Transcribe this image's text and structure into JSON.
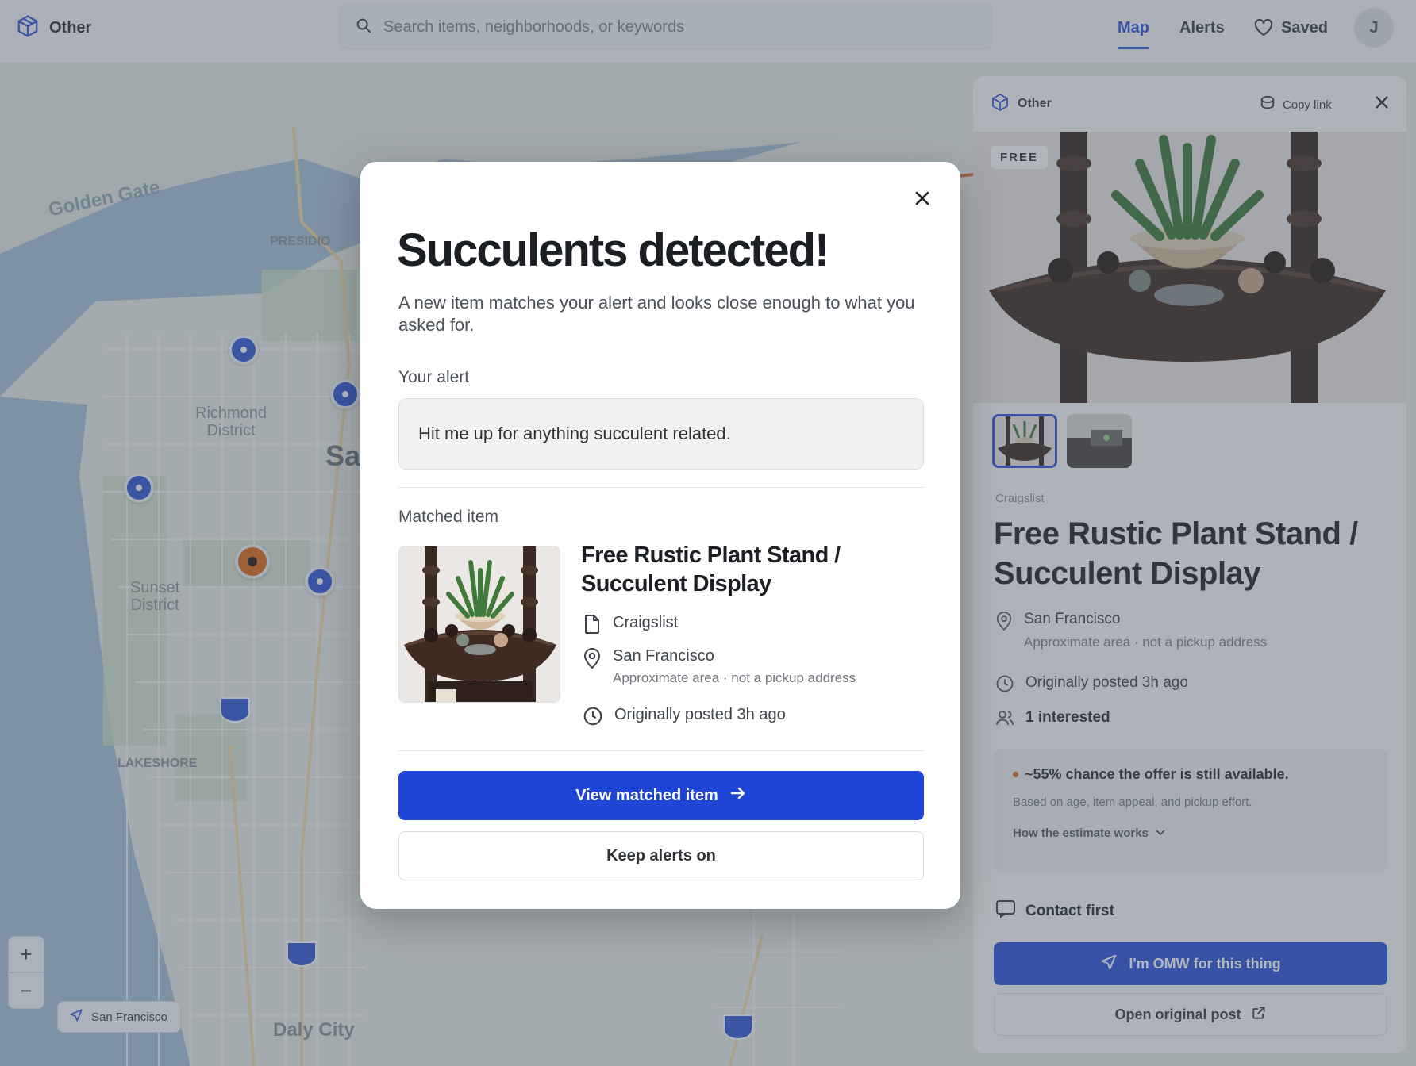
{
  "brand": {
    "label": "Other"
  },
  "search": {
    "placeholder": "Search items, neighborhoods, or keywords"
  },
  "nav": {
    "map": "Map",
    "alerts": "Alerts",
    "saved": "Saved",
    "active": "Map",
    "avatar_initial": "J"
  },
  "map": {
    "labels": {
      "golden_gate": "Golden Gate",
      "presidio": "PRESIDIO",
      "richmond": "Richmond\nDistrict",
      "sunset": "Sunset\nDistrict",
      "lakeshore": "LAKESHORE",
      "daly_city": "Daly City",
      "sa": "Sa"
    },
    "zoom_in": "+",
    "zoom_out": "−",
    "location_button": "San Francisco",
    "pin_color": "#3558d8",
    "selected_pin_color": "#e06a1b"
  },
  "side_panel": {
    "category": "Other",
    "copy_link": "Copy link",
    "badge": "FREE",
    "source": "Craigslist",
    "title": "Free Rustic Plant Stand / Succulent Display",
    "location": "San Francisco",
    "location_sub": "Approximate area · not a pickup address",
    "posted": "Originally posted 3h ago",
    "interested": "1 interested",
    "odds": {
      "headline": "~55% chance the offer is still available.",
      "basis": "Based on age, item appeal, and pickup effort.",
      "how": "How the estimate works"
    },
    "contact": "Contact first",
    "omw_button": "I'm OMW for this thing",
    "open_post_button": "Open original post"
  },
  "modal": {
    "title": "Succulents detected!",
    "description": "A new item matches your alert and looks close enough to what you asked for.",
    "alert_label": "Your alert",
    "alert_text": "Hit me up for anything succulent related.",
    "matched_label": "Matched item",
    "item": {
      "title": "Free Rustic Plant Stand / Succulent Display",
      "source": "Craigslist",
      "location": "San Francisco",
      "location_sub": "Approximate area · not a pickup address",
      "posted": "Originally posted 3h ago"
    },
    "primary_button": "View matched item",
    "secondary_button": "Keep alerts on",
    "accent_color": "#1f45d6"
  }
}
